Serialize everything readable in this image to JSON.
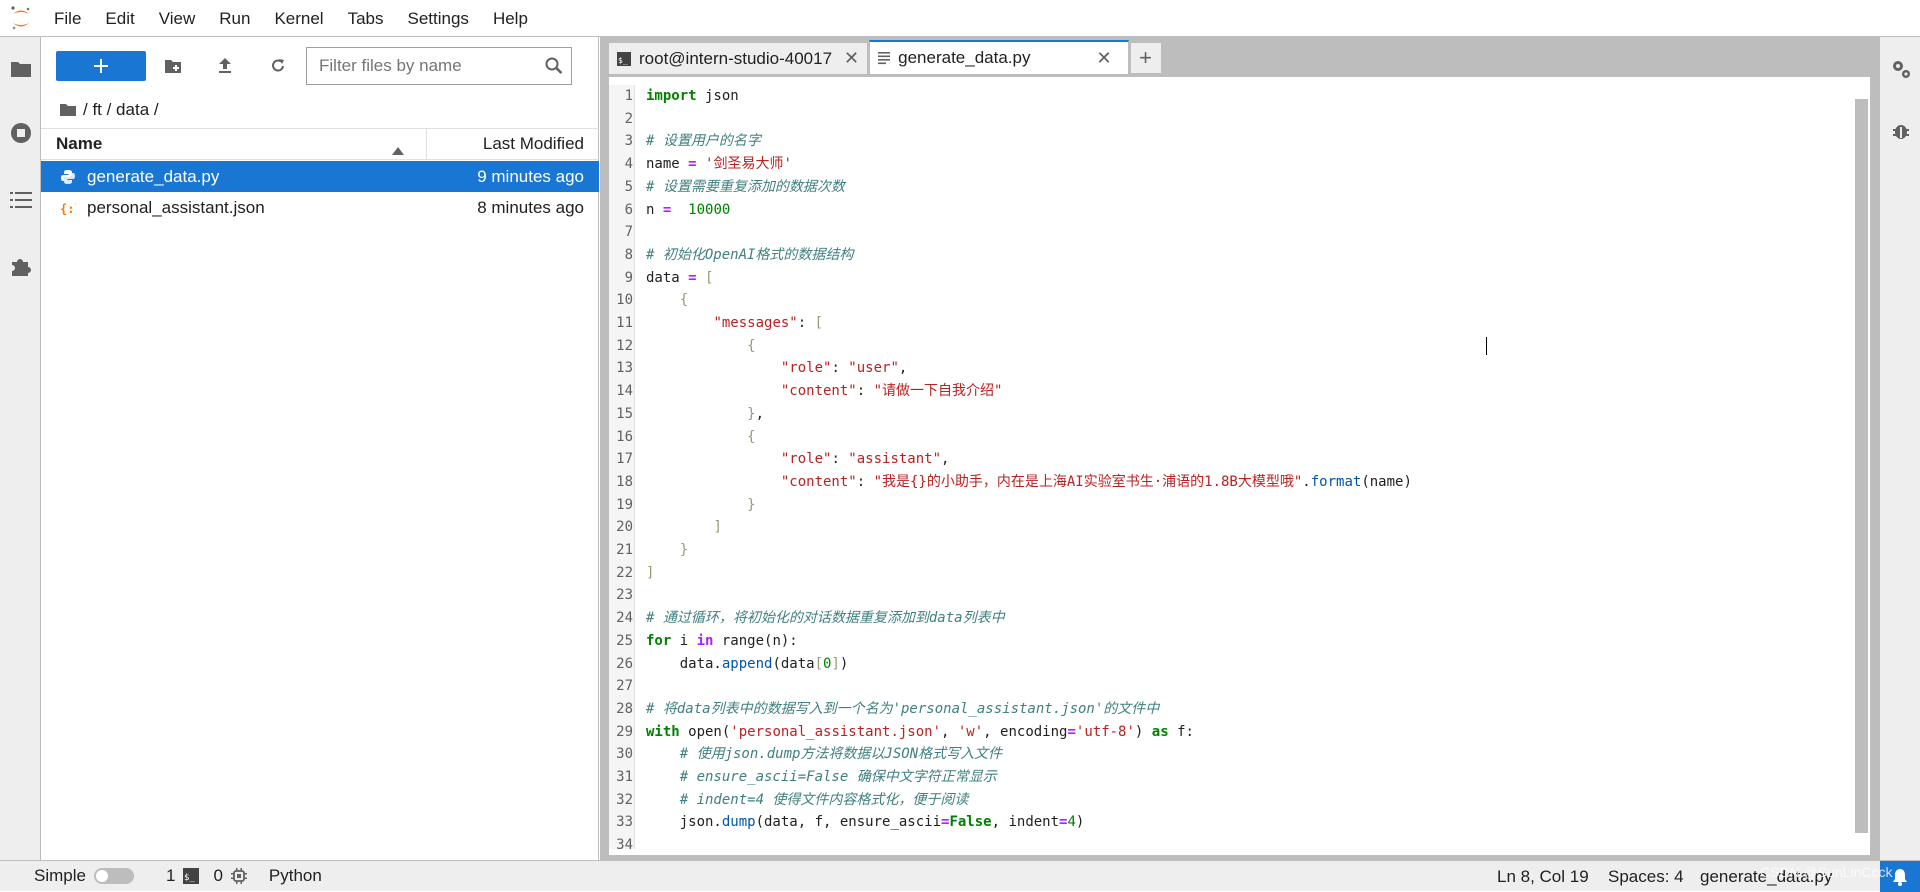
{
  "menu": [
    "File",
    "Edit",
    "View",
    "Run",
    "Kernel",
    "Tabs",
    "Settings",
    "Help"
  ],
  "filebrowser": {
    "filter_placeholder": "Filter files by name",
    "breadcrumb": "/ ft / data /",
    "columns": {
      "name": "Name",
      "modified": "Last Modified"
    },
    "files": [
      {
        "name": "generate_data.py",
        "modified": "9 minutes ago",
        "icon": "python-file-icon",
        "selected": true
      },
      {
        "name": "personal_assistant.json",
        "modified": "8 minutes ago",
        "icon": "json-file-icon",
        "selected": false
      }
    ]
  },
  "tabs": [
    {
      "title": "root@intern-studio-40017",
      "icon": "terminal-icon",
      "active": false
    },
    {
      "title": "generate_data.py",
      "icon": "text-file-icon",
      "active": true
    }
  ],
  "code_lines": [
    [
      [
        "kw",
        "import"
      ],
      [
        "p",
        " json"
      ]
    ],
    [],
    [
      [
        "cm",
        "# 设置用户的名字"
      ]
    ],
    [
      [
        "p",
        "name "
      ],
      [
        "op",
        "="
      ],
      [
        "p",
        " "
      ],
      [
        "st",
        "'剑圣易大师'"
      ]
    ],
    [
      [
        "cm",
        "# 设置需要重复添加的数据次数"
      ]
    ],
    [
      [
        "p",
        "n "
      ],
      [
        "op",
        "="
      ],
      [
        "p",
        "  "
      ],
      [
        "nm",
        "10000"
      ]
    ],
    [],
    [
      [
        "cm",
        "# 初始化OpenAI格式的数据结构"
      ]
    ],
    [
      [
        "p",
        "data "
      ],
      [
        "op",
        "="
      ],
      [
        "p",
        " "
      ],
      [
        "br",
        "["
      ]
    ],
    [
      [
        "p",
        "    "
      ],
      [
        "br",
        "{"
      ]
    ],
    [
      [
        "p",
        "        "
      ],
      [
        "st",
        "\"messages\""
      ],
      [
        "p",
        ": "
      ],
      [
        "br",
        "["
      ]
    ],
    [
      [
        "p",
        "            "
      ],
      [
        "br",
        "{"
      ]
    ],
    [
      [
        "p",
        "                "
      ],
      [
        "st",
        "\"role\""
      ],
      [
        "p",
        ": "
      ],
      [
        "st",
        "\"user\""
      ],
      [
        "p",
        ","
      ]
    ],
    [
      [
        "p",
        "                "
      ],
      [
        "st",
        "\"content\""
      ],
      [
        "p",
        ": "
      ],
      [
        "st",
        "\"请做一下自我介绍\""
      ]
    ],
    [
      [
        "p",
        "            "
      ],
      [
        "br",
        "}"
      ],
      [
        "p",
        ","
      ]
    ],
    [
      [
        "p",
        "            "
      ],
      [
        "br",
        "{"
      ]
    ],
    [
      [
        "p",
        "                "
      ],
      [
        "st",
        "\"role\""
      ],
      [
        "p",
        ": "
      ],
      [
        "st",
        "\"assistant\""
      ],
      [
        "p",
        ","
      ]
    ],
    [
      [
        "p",
        "                "
      ],
      [
        "st",
        "\"content\""
      ],
      [
        "p",
        ": "
      ],
      [
        "st",
        "\"我是{}的小助手，内在是上海AI实验室书生·浦语的1.8B大模型哦\""
      ],
      [
        "p",
        "."
      ],
      [
        "fn",
        "format"
      ],
      [
        "p",
        "(name)"
      ]
    ],
    [
      [
        "p",
        "            "
      ],
      [
        "br",
        "}"
      ]
    ],
    [
      [
        "p",
        "        "
      ],
      [
        "br",
        "]"
      ]
    ],
    [
      [
        "p",
        "    "
      ],
      [
        "br",
        "}"
      ]
    ],
    [
      [
        "br",
        "]"
      ]
    ],
    [],
    [
      [
        "cm",
        "# 通过循环，将初始化的对话数据重复添加到data列表中"
      ]
    ],
    [
      [
        "kw",
        "for"
      ],
      [
        "p",
        " i "
      ],
      [
        "op",
        "in"
      ],
      [
        "p",
        " range(n):"
      ]
    ],
    [
      [
        "p",
        "    data."
      ],
      [
        "fn",
        "append"
      ],
      [
        "p",
        "(data"
      ],
      [
        "br",
        "["
      ],
      [
        "nm",
        "0"
      ],
      [
        "br",
        "]"
      ],
      [
        "p",
        ")"
      ]
    ],
    [],
    [
      [
        "cm",
        "# 将data列表中的数据写入到一个名为'personal_assistant.json'的文件中"
      ]
    ],
    [
      [
        "kw",
        "with"
      ],
      [
        "p",
        " open("
      ],
      [
        "st",
        "'personal_assistant.json'"
      ],
      [
        "p",
        ", "
      ],
      [
        "st",
        "'w'"
      ],
      [
        "p",
        ", encoding"
      ],
      [
        "op",
        "="
      ],
      [
        "st",
        "'utf-8'"
      ],
      [
        "p",
        ") "
      ],
      [
        "kw",
        "as"
      ],
      [
        "p",
        " f:"
      ]
    ],
    [
      [
        "p",
        "    "
      ],
      [
        "cm",
        "# 使用json.dump方法将数据以JSON格式写入文件"
      ]
    ],
    [
      [
        "p",
        "    "
      ],
      [
        "cm",
        "# ensure_ascii=False 确保中文字符正常显示"
      ]
    ],
    [
      [
        "p",
        "    "
      ],
      [
        "cm",
        "# indent=4 使得文件内容格式化，便于阅读"
      ]
    ],
    [
      [
        "p",
        "    json."
      ],
      [
        "fn",
        "dump"
      ],
      [
        "p",
        "(data, f, ensure_ascii"
      ],
      [
        "op",
        "="
      ],
      [
        "kw",
        "False"
      ],
      [
        "p",
        ", indent"
      ],
      [
        "op",
        "="
      ],
      [
        "nm",
        "4"
      ],
      [
        "p",
        ")"
      ]
    ],
    []
  ],
  "status": {
    "mode_label": "Simple",
    "terminals_count": "1",
    "kernels_count": "0",
    "kernel_name": "Python",
    "cursor": "Ln 8, Col 19",
    "spaces": "Spaces: 4",
    "filename": "generate_data.py"
  },
  "watermark": "CSDN @SunLinCcck"
}
